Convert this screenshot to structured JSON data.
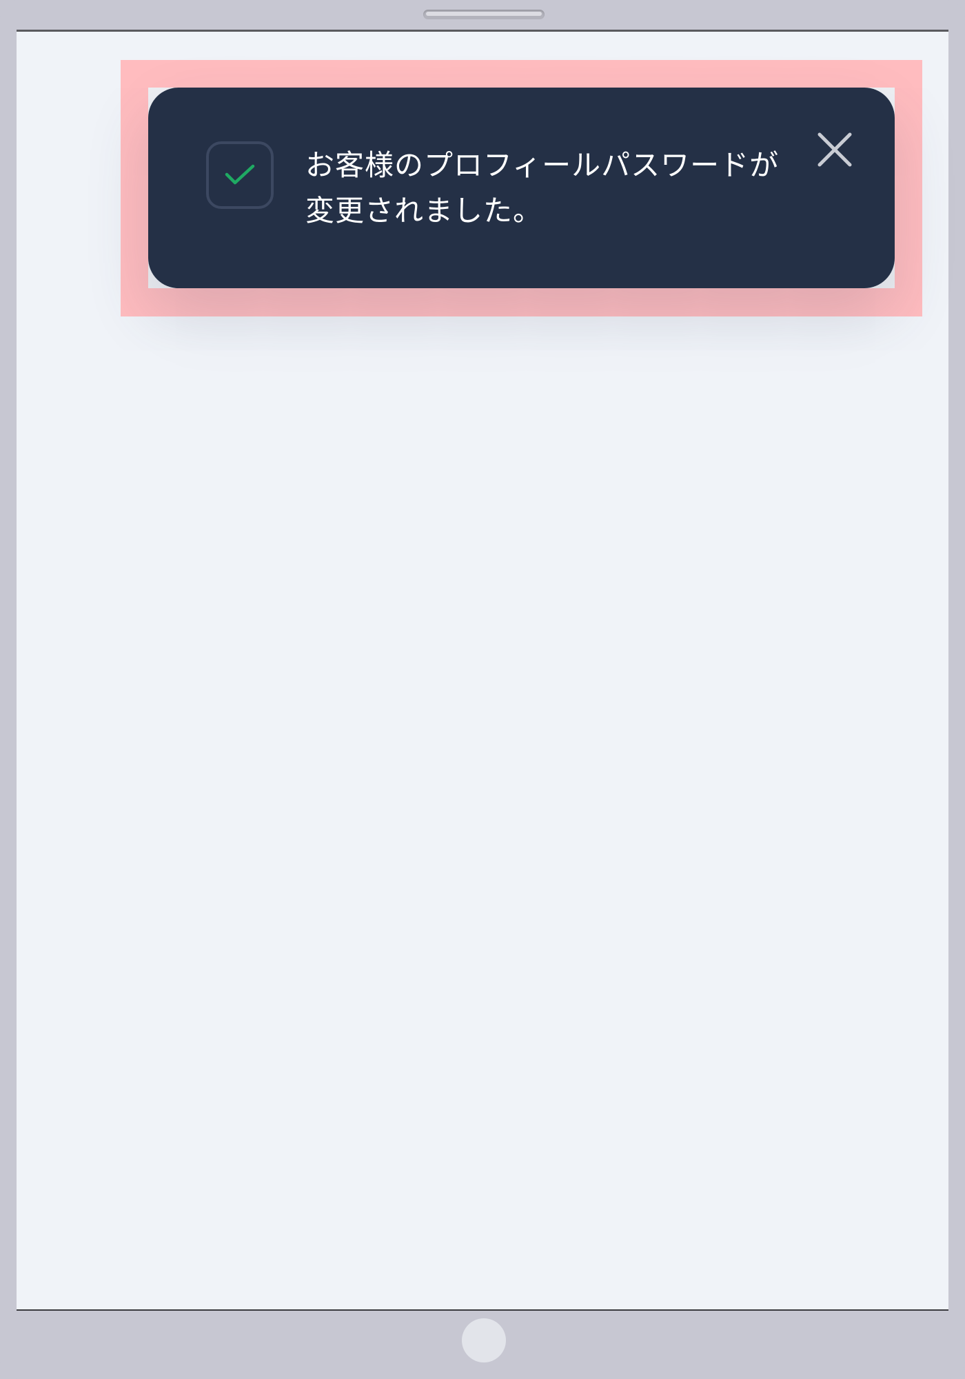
{
  "toast": {
    "message": "お客様のプロフィールパスワードが変更されました。",
    "status": "success",
    "icon": "check-icon",
    "close_icon": "close-icon"
  },
  "colors": {
    "toast_background": "#243046",
    "check_color": "#1faa63",
    "highlight": "#ffbcbf",
    "screen_background": "#f0f3f8",
    "device_frame": "#c7c7d2"
  }
}
